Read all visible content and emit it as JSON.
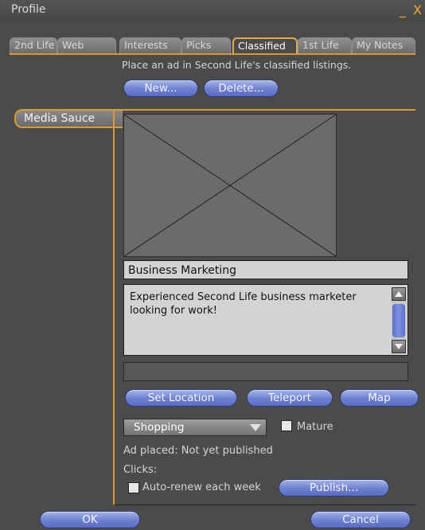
{
  "window": {
    "title": "Profile",
    "controls": "_ X"
  },
  "tabs": [
    {
      "label": "2nd Life",
      "active": false
    },
    {
      "label": "Web",
      "active": false
    },
    {
      "label": "Interests",
      "active": false
    },
    {
      "label": "Picks",
      "active": false
    },
    {
      "label": "Classified",
      "active": true
    },
    {
      "label": "1st Life",
      "active": false
    },
    {
      "label": "My Notes",
      "active": false
    }
  ],
  "classified": {
    "intro": "Place an ad in Second Life's classified listings.",
    "new_button": "New...",
    "delete_button": "Delete...",
    "list_item": "Media Sauce",
    "name": "Business Marketing",
    "description_line1": "Experienced Second Life business marketer",
    "description_line2": "looking for work!",
    "location_value": "",
    "set_location_button": "Set Location",
    "teleport_button": "Teleport",
    "map_button": "Map",
    "category": "Shopping",
    "mature_label": "Mature",
    "ad_status": "Ad placed: Not yet published",
    "clicks_label": "Clicks:",
    "auto_renew_label": "Auto-renew each week",
    "publish_button": "Publish..."
  },
  "footer": {
    "ok_button": "OK",
    "cancel_button": "Cancel"
  },
  "colors": {
    "accent": "#d99a3c",
    "button_blue": "#6d7fcf"
  }
}
